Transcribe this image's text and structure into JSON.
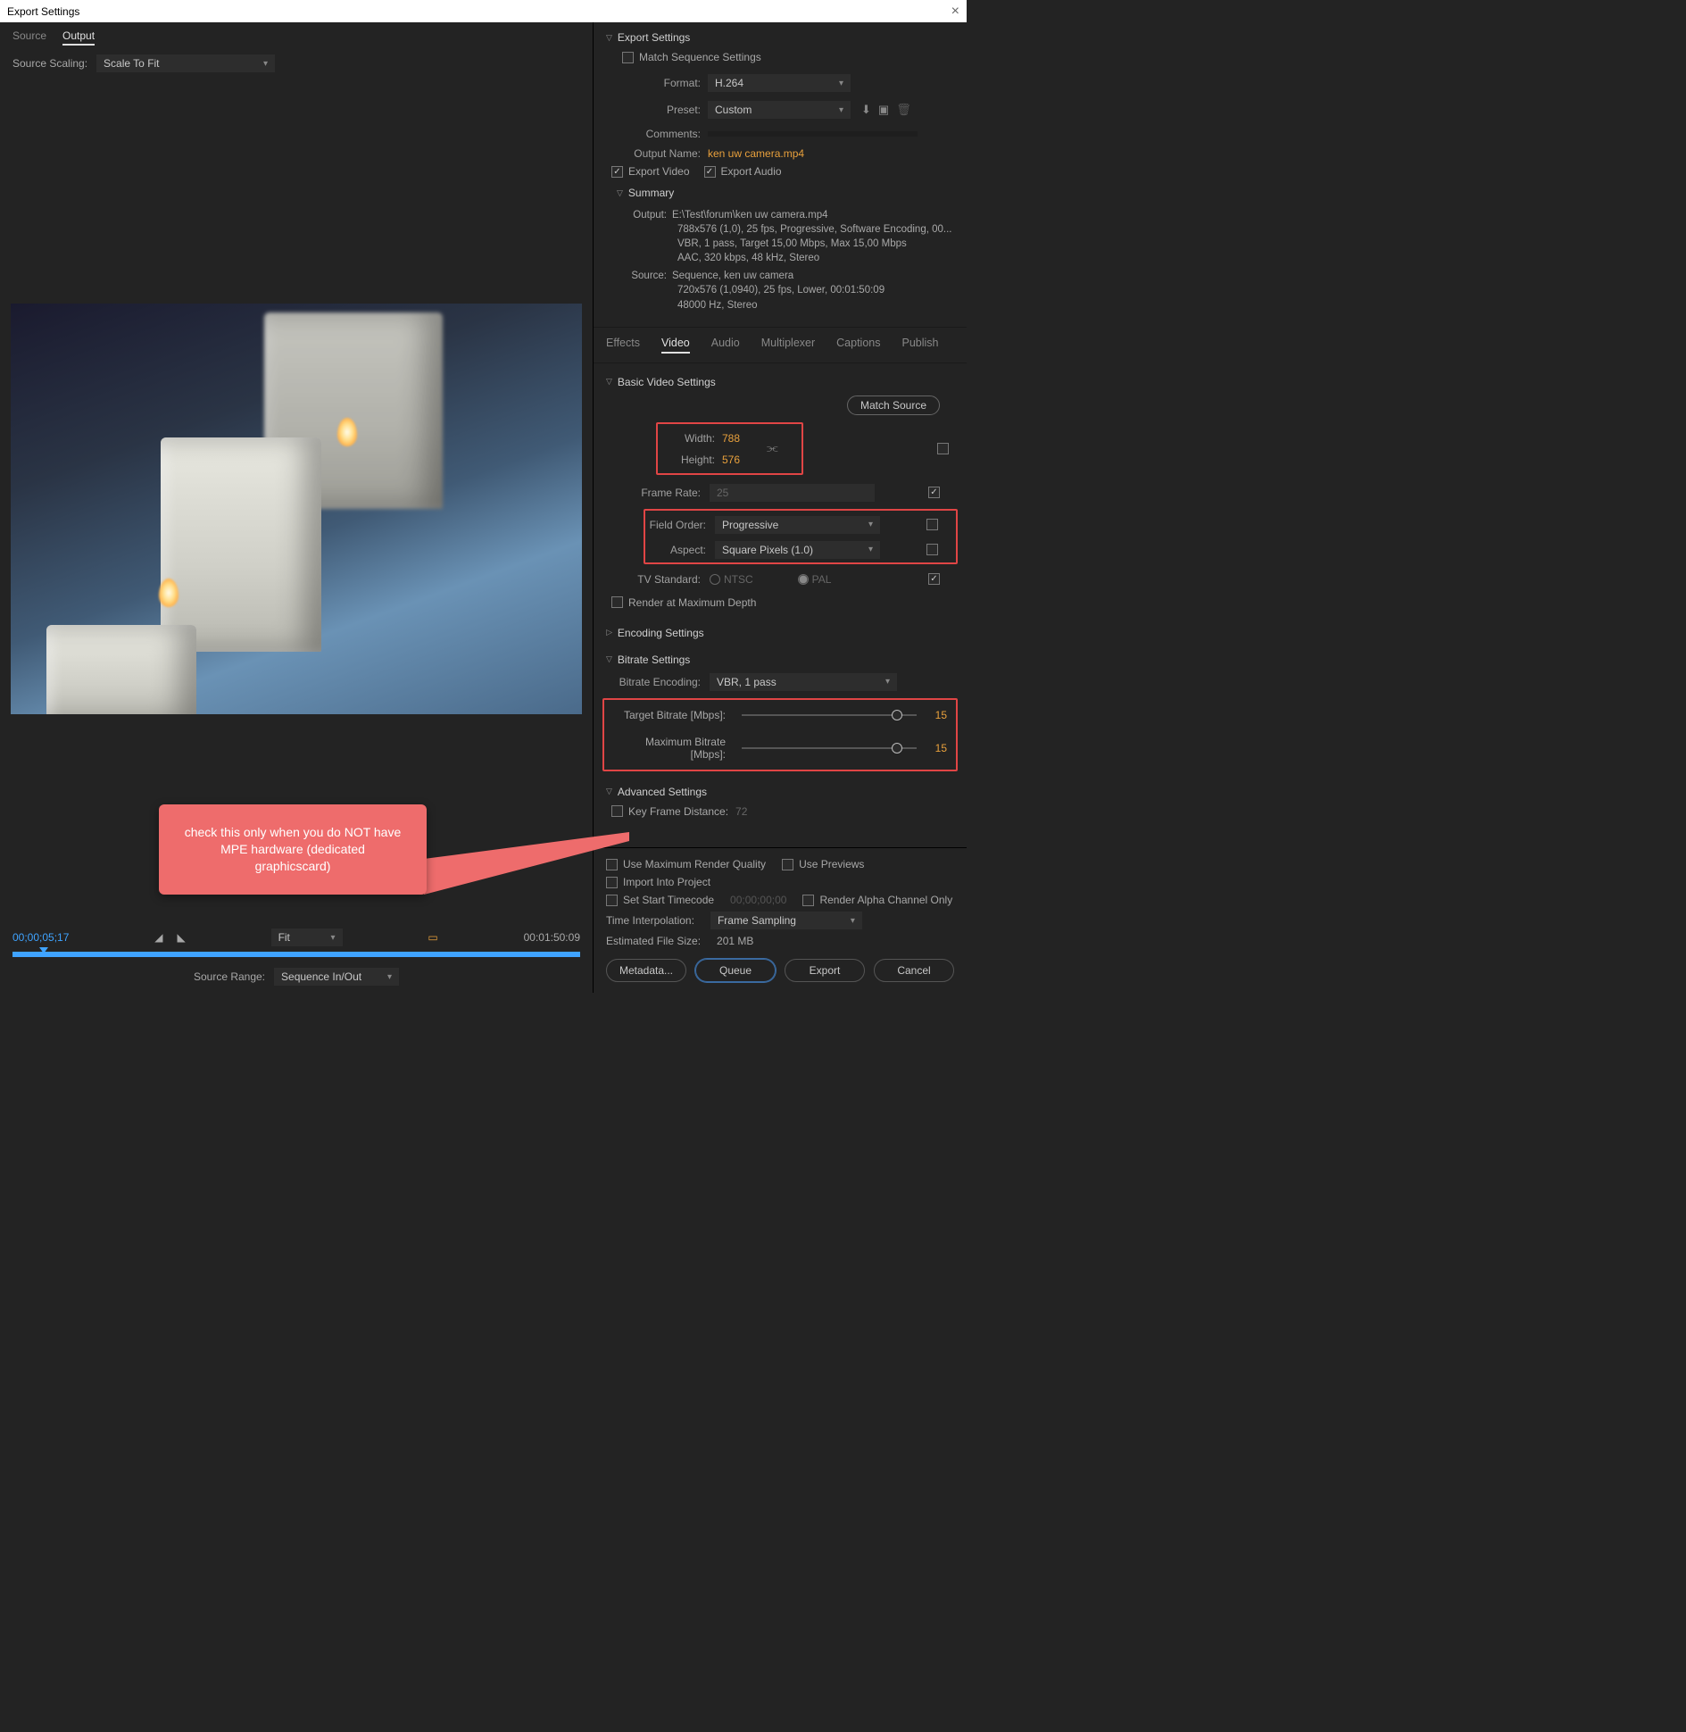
{
  "window": {
    "title": "Export Settings"
  },
  "leftTabs": {
    "source": "Source",
    "output": "Output"
  },
  "sourceScaling": {
    "label": "Source Scaling:",
    "value": "Scale To Fit"
  },
  "callout": {
    "text": "check this only when you do NOT have MPE hardware (dedicated graphicscard)"
  },
  "timeline": {
    "current": "00;00;05;17",
    "duration": "00:01:50:09",
    "fitLabel": "Fit",
    "sourceRangeLabel": "Source Range:",
    "sourceRangeValue": "Sequence In/Out"
  },
  "exportSettings": {
    "heading": "Export Settings",
    "matchSeq": "Match Sequence Settings",
    "format": {
      "label": "Format:",
      "value": "H.264"
    },
    "preset": {
      "label": "Preset:",
      "value": "Custom"
    },
    "comments": {
      "label": "Comments:"
    },
    "outputName": {
      "label": "Output Name:",
      "value": "ken uw camera.mp4"
    },
    "exportVideo": "Export Video",
    "exportAudio": "Export Audio"
  },
  "summary": {
    "heading": "Summary",
    "output": {
      "label": "Output:",
      "l1": "E:\\Test\\forum\\ken uw camera.mp4",
      "l2": "788x576 (1,0), 25 fps, Progressive, Software Encoding, 00...",
      "l3": "VBR, 1 pass, Target 15,00 Mbps, Max 15,00 Mbps",
      "l4": "AAC, 320 kbps, 48 kHz, Stereo"
    },
    "source": {
      "label": "Source:",
      "l1": "Sequence, ken uw camera",
      "l2": "720x576 (1,0940), 25 fps, Lower, 00:01:50:09",
      "l3": "48000 Hz, Stereo"
    }
  },
  "subTabs": {
    "effects": "Effects",
    "video": "Video",
    "audio": "Audio",
    "mux": "Multiplexer",
    "captions": "Captions",
    "publish": "Publish"
  },
  "basicVideo": {
    "heading": "Basic Video Settings",
    "matchSource": "Match Source",
    "widthLabel": "Width:",
    "width": "788",
    "heightLabel": "Height:",
    "height": "576",
    "frameRateLabel": "Frame Rate:",
    "frameRate": "25",
    "fieldOrderLabel": "Field Order:",
    "fieldOrder": "Progressive",
    "aspectLabel": "Aspect:",
    "aspect": "Square Pixels (1.0)",
    "tvStdLabel": "TV Standard:",
    "ntsc": "NTSC",
    "pal": "PAL",
    "renderMaxDepth": "Render at Maximum Depth"
  },
  "encoding": {
    "heading": "Encoding Settings"
  },
  "bitrate": {
    "heading": "Bitrate Settings",
    "encodingLabel": "Bitrate Encoding:",
    "encoding": "VBR, 1 pass",
    "targetLabel": "Target Bitrate [Mbps]:",
    "target": "15",
    "maxLabel": "Maximum Bitrate [Mbps]:",
    "max": "15"
  },
  "advanced": {
    "heading": "Advanced Settings",
    "keyframeLabel": "Key Frame Distance:",
    "keyframe": "72"
  },
  "bottom": {
    "useMaxRender": "Use Maximum Render Quality",
    "usePreviews": "Use Previews",
    "importProject": "Import Into Project",
    "setStartTC": "Set Start Timecode",
    "startTC": "00;00;00;00",
    "renderAlpha": "Render Alpha Channel Only",
    "timeInterpLabel": "Time Interpolation:",
    "timeInterp": "Frame Sampling",
    "estSizeLabel": "Estimated File Size:",
    "estSize": "201 MB"
  },
  "buttons": {
    "metadata": "Metadata...",
    "queue": "Queue",
    "export": "Export",
    "cancel": "Cancel"
  }
}
